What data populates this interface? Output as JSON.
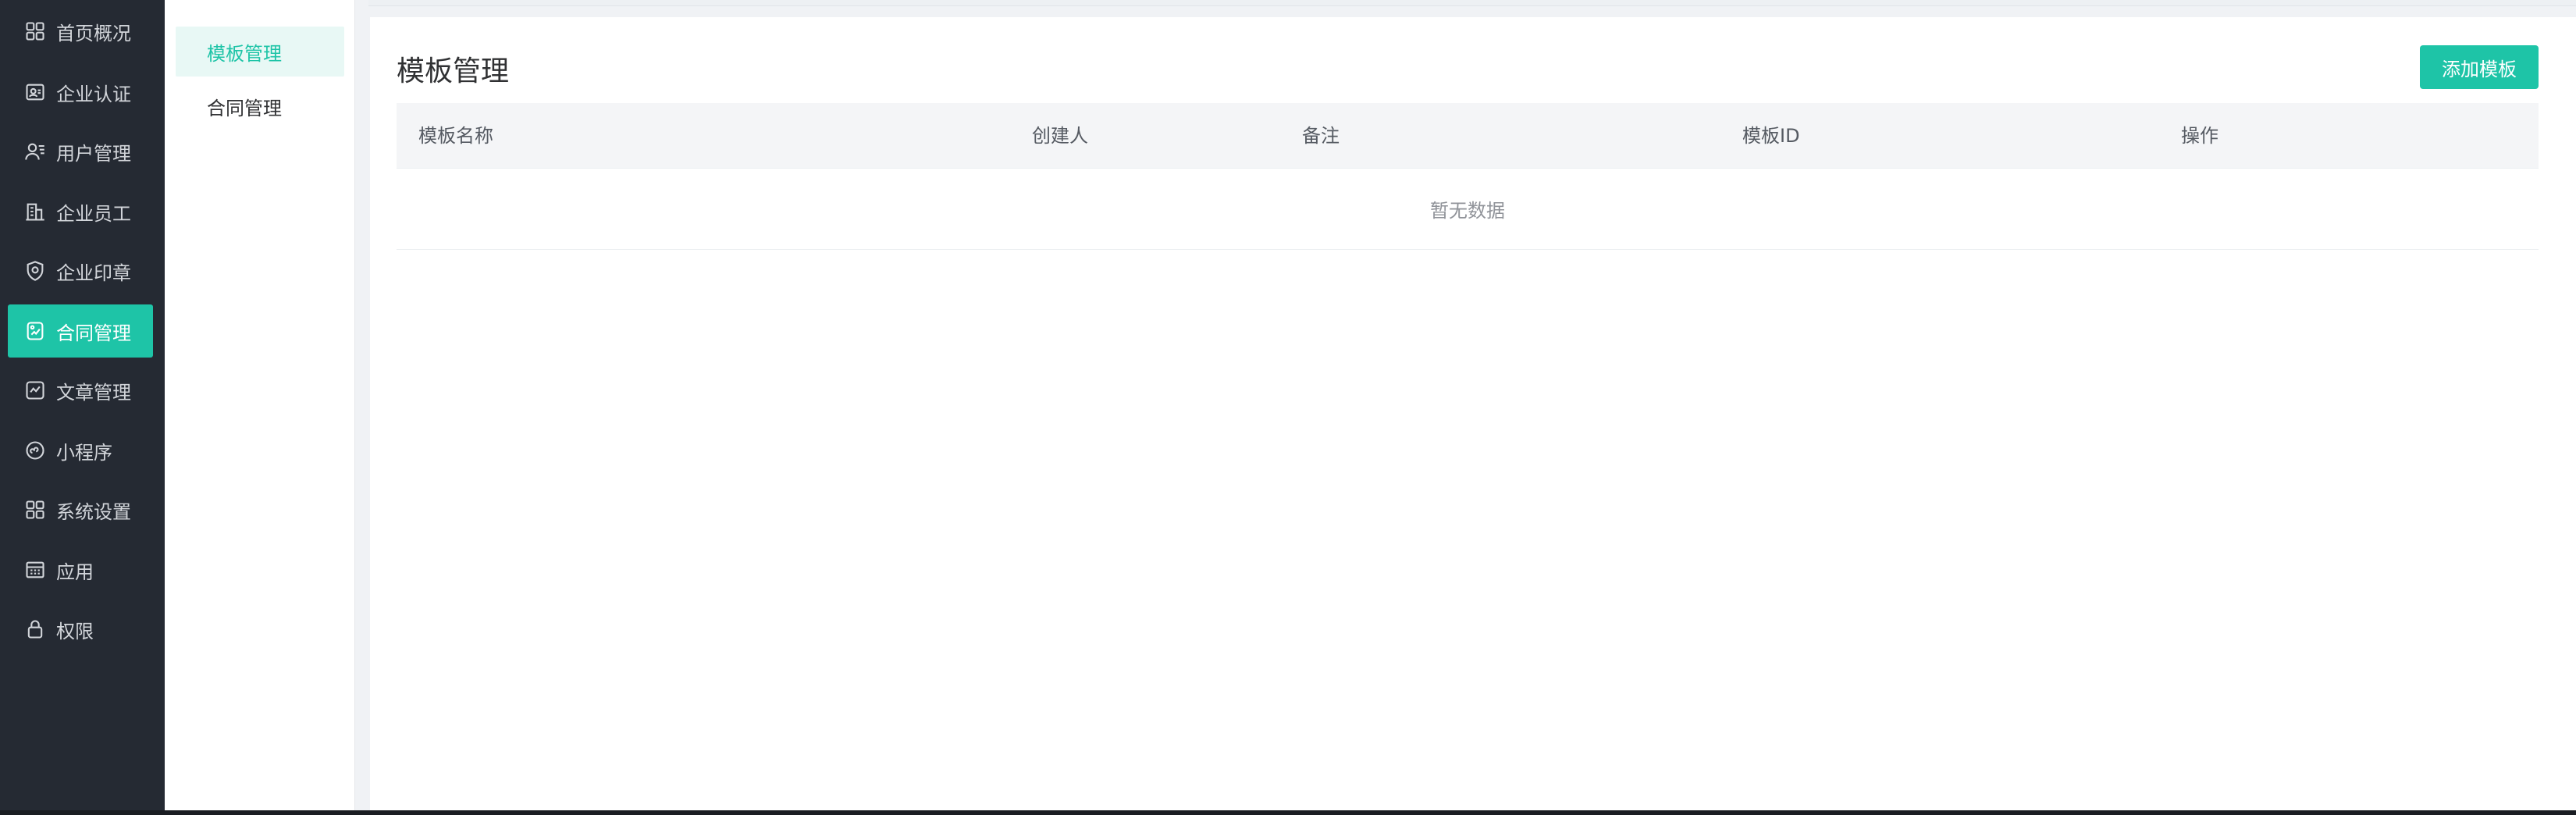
{
  "sidebar": {
    "items": [
      {
        "label": "首页概况",
        "icon": "dashboard-icon",
        "active": false
      },
      {
        "label": "企业认证",
        "icon": "id-card-icon",
        "active": false
      },
      {
        "label": "用户管理",
        "icon": "user-list-icon",
        "active": false
      },
      {
        "label": "企业员工",
        "icon": "building-icon",
        "active": false
      },
      {
        "label": "企业印章",
        "icon": "shield-stamp-icon",
        "active": false
      },
      {
        "label": "合同管理",
        "icon": "contract-icon",
        "active": true
      },
      {
        "label": "文章管理",
        "icon": "article-icon",
        "active": false
      },
      {
        "label": "小程序",
        "icon": "mini-program-icon",
        "active": false
      },
      {
        "label": "系统设置",
        "icon": "grid-settings-icon",
        "active": false
      },
      {
        "label": "应用",
        "icon": "apps-icon",
        "active": false
      },
      {
        "label": "权限",
        "icon": "lock-icon",
        "active": false
      }
    ]
  },
  "submenu": {
    "items": [
      {
        "label": "模板管理",
        "active": true
      },
      {
        "label": "合同管理",
        "active": false
      }
    ]
  },
  "main": {
    "title": "模板管理",
    "add_button_label": "添加模板",
    "table": {
      "columns": [
        "模板名称",
        "创建人",
        "备注",
        "模板ID",
        "操作"
      ],
      "rows": [],
      "empty_text": "暂无数据"
    }
  },
  "colors": {
    "accent": "#1ec4a7",
    "sidebar_bg": "#252a33",
    "submenu_active_bg": "#e8f8f5"
  }
}
